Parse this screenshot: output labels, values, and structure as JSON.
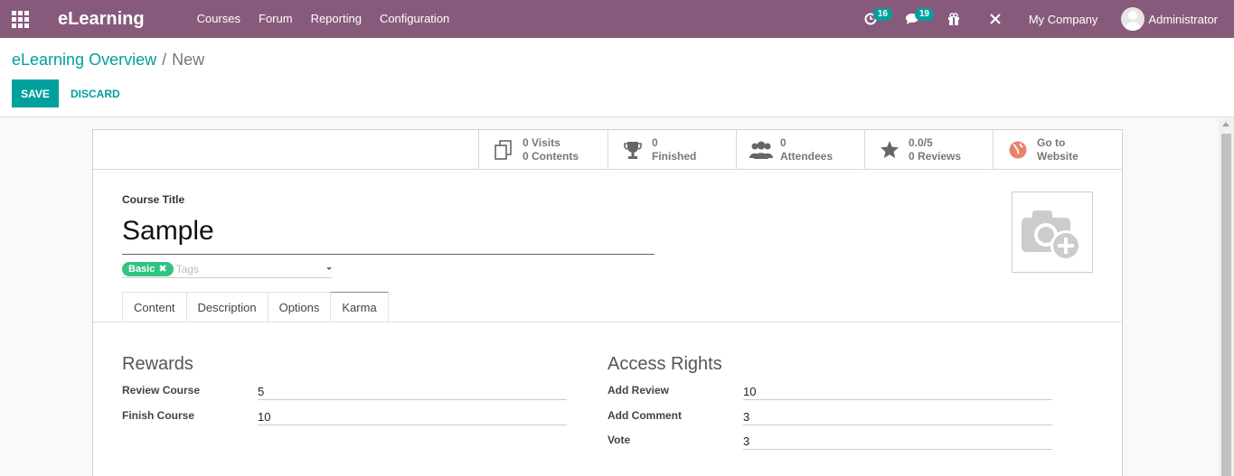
{
  "navbar": {
    "brand": "eLearning",
    "menu": [
      "Courses",
      "Forum",
      "Reporting",
      "Configuration"
    ],
    "activity_count": "16",
    "messages_count": "19",
    "company": "My Company",
    "user": "Administrator",
    "color": "#875a7b"
  },
  "breadcrumb": {
    "parent": "eLearning Overview",
    "separator": "/",
    "current": "New"
  },
  "actions": {
    "save": "SAVE",
    "discard": "DISCARD"
  },
  "stat_buttons": [
    {
      "icon": "documents-icon",
      "line1": "0 Visits",
      "line2": "0 Contents"
    },
    {
      "icon": "trophy-icon",
      "line1": "0",
      "line2": "Finished"
    },
    {
      "icon": "users-icon",
      "line1": "0",
      "line2": "Attendees"
    },
    {
      "icon": "star-icon",
      "line1": "0.0/5",
      "line2": "0 Reviews"
    },
    {
      "icon": "globe-icon",
      "line1": "Go to",
      "line2": "Website"
    }
  ],
  "course": {
    "title_label": "Course Title",
    "title_value": "Sample",
    "tag": "Basic",
    "tags_placeholder": "Tags"
  },
  "tabs": [
    "Content",
    "Description",
    "Options",
    "Karma"
  ],
  "active_tab": "Karma",
  "rewards": {
    "title": "Rewards",
    "fields": [
      {
        "label": "Review Course",
        "value": "5"
      },
      {
        "label": "Finish Course",
        "value": "10"
      }
    ]
  },
  "access_rights": {
    "title": "Access Rights",
    "fields": [
      {
        "label": "Add Review",
        "value": "10"
      },
      {
        "label": "Add Comment",
        "value": "3"
      },
      {
        "label": "Vote",
        "value": "3"
      }
    ]
  },
  "colors": {
    "accent": "#00a09d",
    "tag": "#30c381"
  }
}
